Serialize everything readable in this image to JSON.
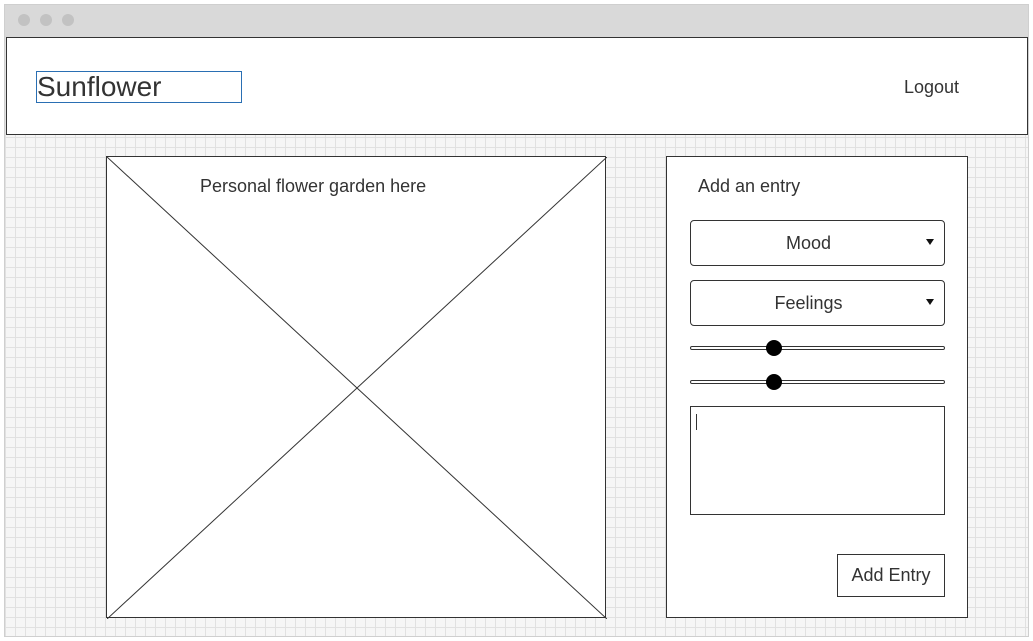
{
  "header": {
    "app_title": "Sunflower",
    "logout_label": "Logout"
  },
  "garden": {
    "placeholder_label": "Personal flower garden here"
  },
  "entry_panel": {
    "title": "Add an entry",
    "mood_select": {
      "selected": "Mood"
    },
    "feelings_select": {
      "selected": "Feelings"
    },
    "sliders": [
      {
        "value_fraction": 0.33
      },
      {
        "value_fraction": 0.33
      }
    ],
    "notes_value": "",
    "add_button_label": "Add Entry"
  },
  "colors": {
    "selection_outline": "#2a6fb3",
    "wireframe_stroke": "#333333",
    "grid_background": "#f6f6f6"
  }
}
